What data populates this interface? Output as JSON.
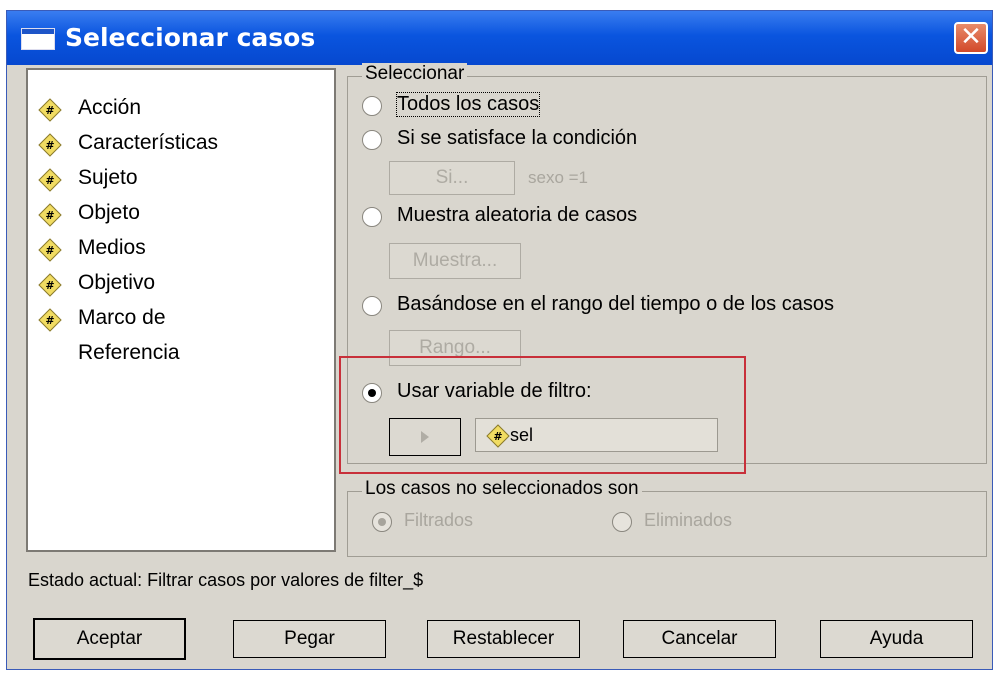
{
  "window": {
    "title": "Seleccionar casos",
    "close_glyph": "✕"
  },
  "variables": [
    {
      "label": "Acción"
    },
    {
      "label": "Características"
    },
    {
      "label": "Sujeto"
    },
    {
      "label": "Objeto"
    },
    {
      "label": "Medios"
    },
    {
      "label": "Objetivo"
    },
    {
      "label": "Marco de"
    },
    {
      "label": "Referencia"
    }
  ],
  "select_group": {
    "legend": "Seleccionar",
    "all_cases": "Todos los casos",
    "condition": "Si se satisface la condición",
    "if_button": "Si...",
    "condition_value": "sexo =1",
    "random_sample": "Muestra aleatoria de casos",
    "sample_button": "Muestra...",
    "range": "Basándose en el rango del tiempo o de los casos",
    "range_button": "Rango...",
    "filter_var": "Usar variable de filtro:",
    "filter_value": "sel",
    "selected_option": "filter_var"
  },
  "unselected_group": {
    "legend": "Los casos no seleccionados son",
    "filtered": "Filtrados",
    "deleted": "Eliminados"
  },
  "status": "Estado actual: Filtrar casos por valores de filter_$",
  "buttons": {
    "accept": "Aceptar",
    "paste": "Pegar",
    "reset": "Restablecer",
    "cancel": "Cancelar",
    "help": "Ayuda"
  },
  "colors": {
    "highlight": "#c8303a",
    "titlebar": "#0a55df",
    "dialog_bg": "#d9d6ce"
  }
}
